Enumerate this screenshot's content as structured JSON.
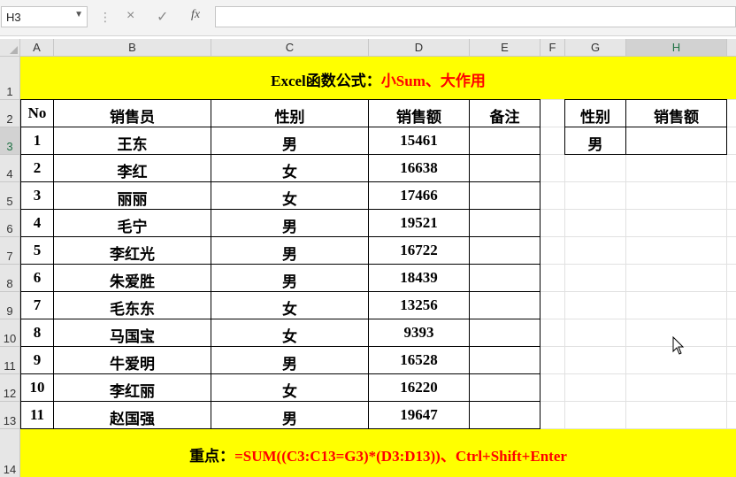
{
  "namebox": {
    "value": "H3"
  },
  "formula_bar": {
    "value": "",
    "fx_label": "fx",
    "cancel_icon": "×",
    "enter_icon": "✓"
  },
  "columns": [
    "A",
    "B",
    "C",
    "D",
    "E",
    "F",
    "G",
    "H"
  ],
  "rows": [
    "1",
    "2",
    "3",
    "4",
    "5",
    "6",
    "7",
    "8",
    "9",
    "10",
    "11",
    "12",
    "13",
    "14"
  ],
  "selected_cell": {
    "column": "H",
    "row": "3"
  },
  "title": {
    "part1": "Excel函数公式：",
    "part2": "小Sum、大作用",
    "color1": "#000000",
    "color2": "#ff0000"
  },
  "table": {
    "headers": [
      "No",
      "销售员",
      "性别",
      "销售额",
      "备注"
    ],
    "rows": [
      [
        "1",
        "王东",
        "男",
        "15461",
        ""
      ],
      [
        "2",
        "李红",
        "女",
        "16638",
        ""
      ],
      [
        "3",
        "丽丽",
        "女",
        "17466",
        ""
      ],
      [
        "4",
        "毛宁",
        "男",
        "19521",
        ""
      ],
      [
        "5",
        "李红光",
        "男",
        "16722",
        ""
      ],
      [
        "6",
        "朱爱胜",
        "男",
        "18439",
        ""
      ],
      [
        "7",
        "毛东东",
        "女",
        "13256",
        ""
      ],
      [
        "8",
        "马国宝",
        "女",
        "9393",
        ""
      ],
      [
        "9",
        "牛爱明",
        "男",
        "16528",
        ""
      ],
      [
        "10",
        "李红丽",
        "女",
        "16220",
        ""
      ],
      [
        "11",
        "赵国强",
        "男",
        "19647",
        ""
      ]
    ]
  },
  "side_table": {
    "headers": [
      "性别",
      "销售额"
    ],
    "row": [
      "男",
      ""
    ]
  },
  "footer": {
    "label": "重点：",
    "formula": "=SUM((C3:C13=G3)*(D3:D13))、Ctrl+Shift+Enter",
    "color": "#ff0000"
  },
  "colors": {
    "band": "#ffff00",
    "header_bg": "#e6e6e6",
    "grid_line": "#e1e1e1",
    "accent": "#217346"
  }
}
